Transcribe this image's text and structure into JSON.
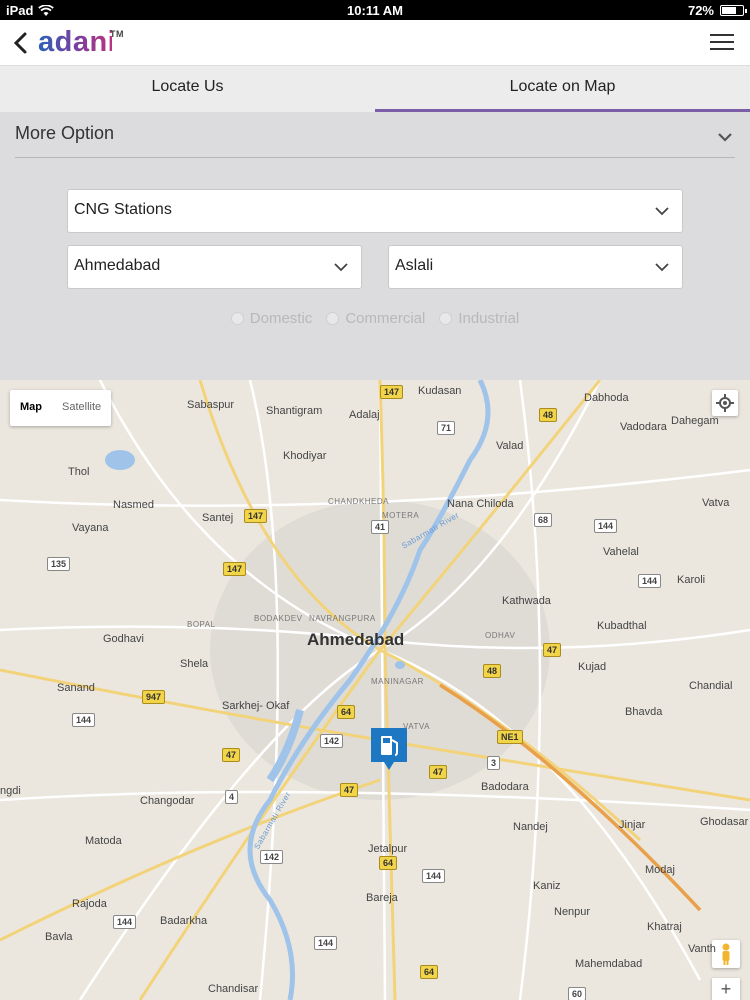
{
  "status_bar": {
    "device": "iPad",
    "time": "10:11 AM",
    "battery": "72%",
    "battery_level": 0.72
  },
  "app_bar": {
    "logo": "adani",
    "logo_tm": "TM"
  },
  "tabs": [
    {
      "label": "Locate Us"
    },
    {
      "label": "Locate on Map"
    }
  ],
  "active_tab": 1,
  "more_options": {
    "label": "More Option",
    "station_type": "CNG Stations",
    "city": "Ahmedabad",
    "area": "Aslali",
    "radios": [
      {
        "label": "Domestic"
      },
      {
        "label": "Commercial"
      },
      {
        "label": "Industrial"
      }
    ]
  },
  "map": {
    "map_type": {
      "map": "Map",
      "satellite": "Satellite"
    },
    "zoom_in": "+",
    "places": [
      "Sabaspur",
      "Shantigram",
      "Adalaj",
      "Kudasan",
      "Dabhoda",
      "Vadodara",
      "Dahegam",
      "Khodiyar",
      "Valad",
      "Thol",
      "Nasmed",
      "Santej",
      "Nana Chiloda",
      "Vatva",
      "Vayana",
      "Vahelal",
      "Karoli",
      "Kathwada",
      "Godhavi",
      "Kubadthal",
      "Shela",
      "Kujad",
      "Sanand",
      "Chandial",
      "Sarkhej- Okaf",
      "Bhavda",
      "Changodar",
      "Badodara",
      "Matoda",
      "Nandej",
      "Jinjar",
      "Ghodasar",
      "ngdi",
      "Jetalpur",
      "Modaj",
      "Rajoda",
      "Bareja",
      "Kaniz",
      "Badarkha",
      "Nenpur",
      "Khatraj",
      "Bavla",
      "Vanth",
      "Mahemdabad",
      "Chandisar"
    ],
    "areas": [
      "CHANDKHEDA",
      "MOTERA",
      "BODAKDEV",
      "NAVRANGPURA",
      "BOPAL",
      "ODHAV",
      "MANINAGAR",
      "VATVA"
    ],
    "city_label": "Ahmedabad",
    "river_label": "Sabarmati River",
    "river_label_2": "Sabarmati River",
    "highways": [
      "147",
      "48",
      "71",
      "147",
      "68",
      "144",
      "41",
      "135",
      "147",
      "144",
      "47",
      "947",
      "48",
      "64",
      "142",
      "144",
      "47",
      "NE1",
      "3",
      "4",
      "47",
      "47",
      "142",
      "64",
      "144",
      "144",
      "144",
      "64",
      "60"
    ]
  }
}
